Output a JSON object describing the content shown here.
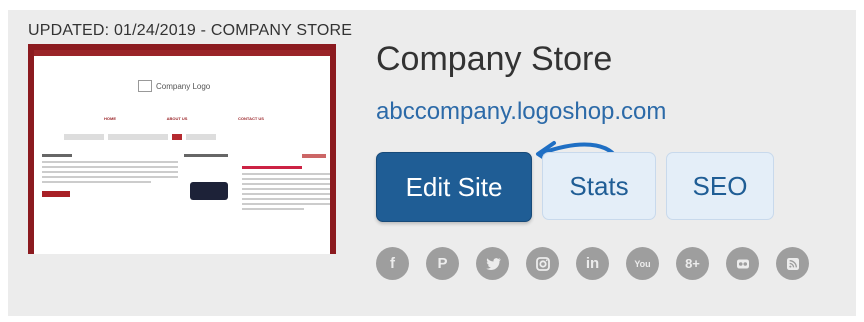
{
  "header": {
    "updated_text": "UPDATED: 01/24/2019 - COMPANY STORE"
  },
  "thumbnail": {
    "logo_text": "Company Logo",
    "nav": [
      "HOME",
      "ABOUT US",
      "CONTACT US"
    ]
  },
  "store": {
    "title": "Company Store",
    "url": "abccompany.logoshop.com"
  },
  "actions": {
    "edit_label": "Edit Site",
    "stats_label": "Stats",
    "seo_label": "SEO"
  },
  "socials": [
    {
      "icon": "facebook-icon",
      "glyph": "f"
    },
    {
      "icon": "pinterest-icon",
      "glyph": "P"
    },
    {
      "icon": "twitter-icon",
      "glyph": ""
    },
    {
      "icon": "instagram-icon",
      "glyph": ""
    },
    {
      "icon": "linkedin-icon",
      "glyph": "in"
    },
    {
      "icon": "youtube-icon",
      "glyph": "You"
    },
    {
      "icon": "google-plus-icon",
      "glyph": "8+"
    },
    {
      "icon": "flickr-icon",
      "glyph": ""
    },
    {
      "icon": "rss-icon",
      "glyph": ""
    }
  ],
  "colors": {
    "primary_button": "#1f5d95",
    "secondary_button_bg": "#e4eef8",
    "link": "#2c6aa8",
    "thumbnail_frame": "#8b1a1f",
    "social_icon": "#9e9e9e"
  }
}
